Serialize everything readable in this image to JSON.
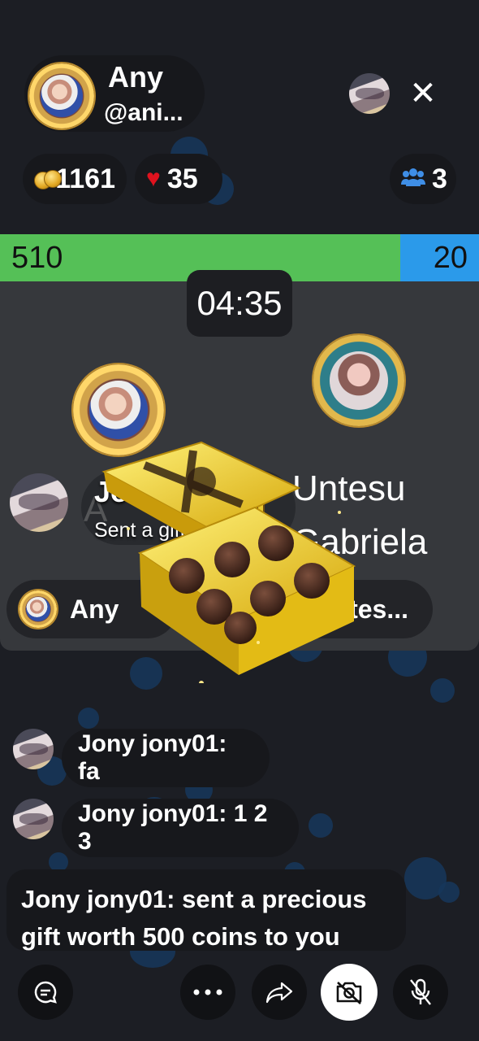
{
  "host": {
    "name": "Any",
    "handle": "@ani..."
  },
  "header": {
    "close_icon": "close-icon"
  },
  "stats": {
    "coins": "1161",
    "likes": "35",
    "viewers": "3"
  },
  "battle": {
    "left_score": "510",
    "right_score": "20",
    "timer": "04:35",
    "left_name_partial": "A",
    "right_name": "Untesu Gabriela",
    "left_label": "Any",
    "right_label": "...ntes..."
  },
  "gift_notice": {
    "sender": "Jony j...",
    "text": "Sent a gift"
  },
  "chat": {
    "messages": [
      {
        "text": "Jony jony01: fa"
      },
      {
        "text": "Jony jony01: 1 2 3"
      }
    ],
    "gift_message": "Jony jony01: sent a precious gift worth 500 coins to you"
  },
  "toolbar": {
    "icons": [
      "chat-icon",
      "more-icon",
      "share-icon",
      "camera-off-icon",
      "mic-off-icon"
    ]
  },
  "colors": {
    "left_team": "#55c057",
    "right_team": "#2b9aea",
    "background": "#1c1e24"
  }
}
